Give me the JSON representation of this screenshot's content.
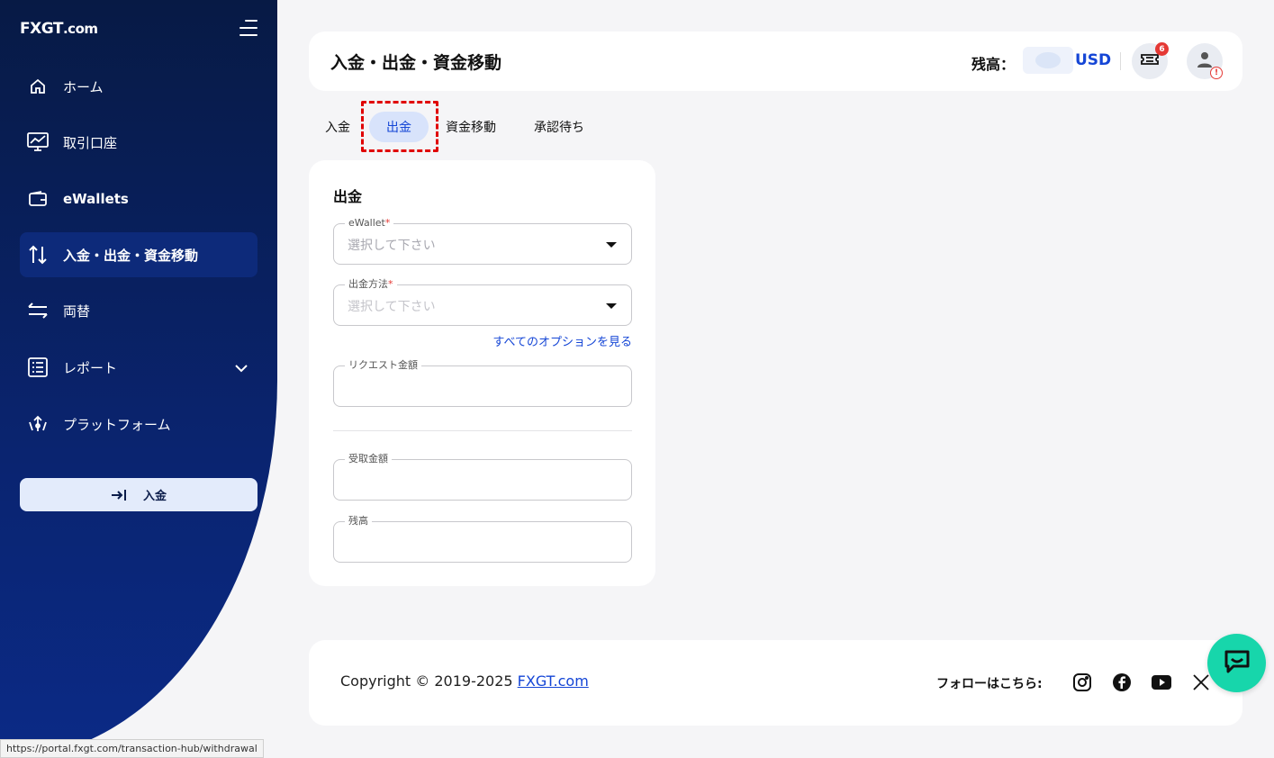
{
  "brand": {
    "logo_fx": "FXGT",
    "logo_dot": ".com"
  },
  "sidebar": {
    "items": [
      {
        "label": "ホーム",
        "icon": "home-icon"
      },
      {
        "label": "取引口座",
        "icon": "chart-monitor-icon"
      },
      {
        "label": "eWallets",
        "icon": "wallet-icon"
      },
      {
        "label": "入金・出金・資金移動",
        "icon": "transfer-arrows-icon"
      },
      {
        "label": "両替",
        "icon": "exchange-icon"
      },
      {
        "label": "レポート",
        "icon": "report-list-icon"
      },
      {
        "label": "プラットフォーム",
        "icon": "platform-icon"
      }
    ],
    "deposit_button": "入金"
  },
  "header": {
    "title": "入金・出金・資金移動",
    "balance_label": "残高：",
    "currency": "USD",
    "notification_count": "6"
  },
  "tabs": [
    "入金",
    "出金",
    "資金移動",
    "承認待ち"
  ],
  "form": {
    "title": "出金",
    "ewallet_label": "eWallet",
    "ewallet_placeholder": "選択して下さい",
    "method_label": "出金方法",
    "method_placeholder": "選択して下さい",
    "options_link": "すべてのオプションを見る",
    "request_amount_label": "リクエスト金額",
    "received_amount_label": "受取金額",
    "balance_label": "残高"
  },
  "footer": {
    "copyright": "Copyright © 2019-2025 ",
    "site_link": "FXGT.com",
    "follow": "フォローはこちら:"
  },
  "status_bar": {
    "url": "https://portal.fxgt.com/transaction-hub/withdrawal"
  },
  "colors": {
    "accent": "#1546d6",
    "sidebar": "#0a2470",
    "chat": "#17d6ab",
    "highlight": "#e00000"
  }
}
